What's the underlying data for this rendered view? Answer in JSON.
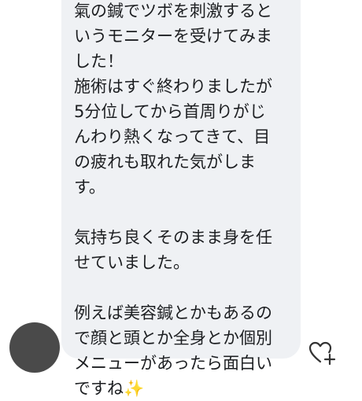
{
  "message": {
    "lines": [
      "氣の鍼でツボを刺激すると",
      "いうモニターを受けてみま",
      "した！",
      "施術はすぐ終わりましたが",
      "5分位してから首周りがじ",
      "んわり熱くなってきて、目",
      "の疲れも取れた気がしま",
      "す。",
      "",
      "気持ち良くそのまま身を任",
      "せていました。",
      "",
      "例えば美容鍼とかもあるの",
      "で顔と頭とか全身とか個別",
      "メニューがあったら面白い",
      "ですね"
    ],
    "emoji": "✨"
  },
  "colors": {
    "bubble": "#eff1f4",
    "text": "#1c1e21",
    "avatar": "#4a4a4a",
    "icon": "#333333"
  },
  "icons": {
    "reaction": "heart-add-icon"
  }
}
